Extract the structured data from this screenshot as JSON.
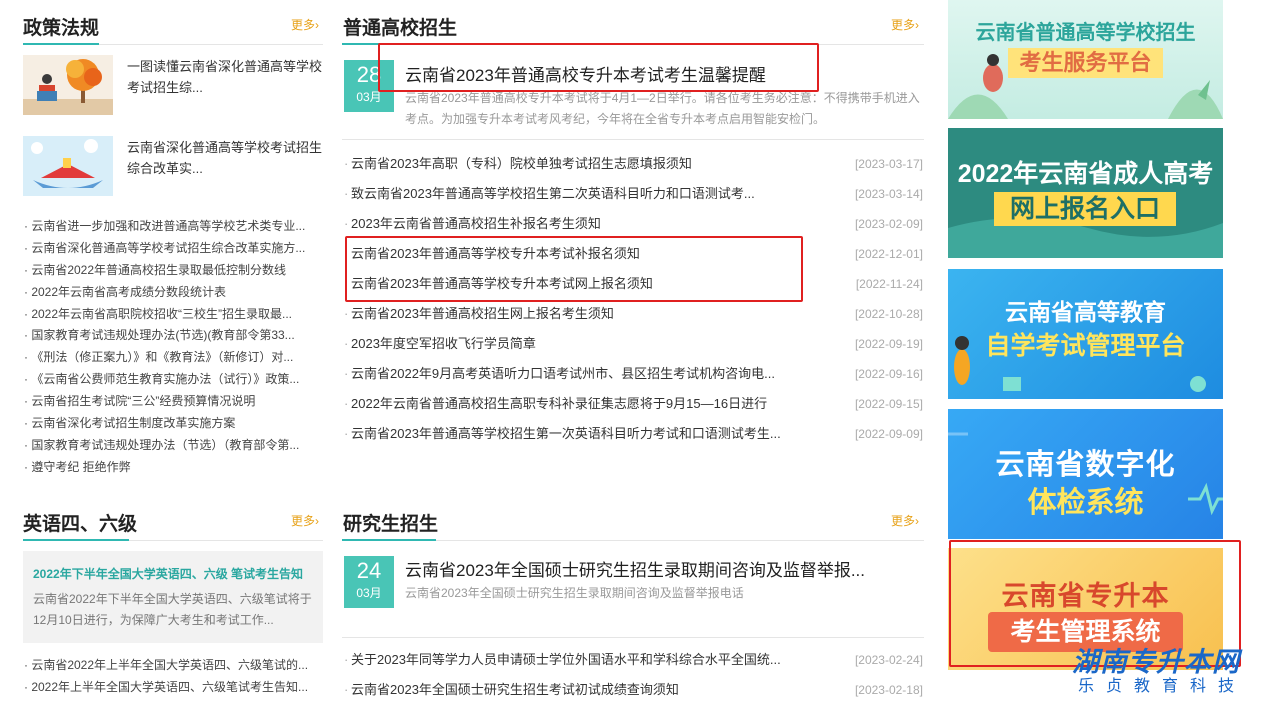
{
  "policy": {
    "title": "政策法规",
    "more": "更多›",
    "features": [
      {
        "text": "一图读懂云南省深化普通高等学校考试招生综..."
      },
      {
        "text": "云南省深化普通高等学校考试招生综合改革实..."
      }
    ],
    "items": [
      "· 云南省进一步加强和改进普通高等学校艺术类专业...",
      "· 云南省深化普通高等学校考试招生综合改革实施方...",
      "· 云南省2022年普通高校招生录取最低控制分数线",
      "· 2022年云南省高考成绩分数段统计表",
      "· 2022年云南省高职院校招收“三校生”招生录取最...",
      "· 国家教育考试违规处理办法(节选)(教育部令第33...",
      "· 《刑法（修正案九）》和《教育法》（新修订）对...",
      "· 《云南省公费师范生教育实施办法（试行）》政策...",
      "· 云南省招生考试院“三公”经费预算情况说明",
      "· 云南省深化考试招生制度改革实施方案",
      "· 国家教育考试违规处理办法（节选）（教育部令第...",
      "· 遵守考纪 拒绝作弊"
    ]
  },
  "admission": {
    "title": "普通高校招生",
    "more": "更多›",
    "top": {
      "day": "28",
      "month": "03月",
      "headline": "云南省2023年普通高校专升本考试考生温馨提醒",
      "summary": "云南省2023年普通高校专升本考试将于4月1—2日举行。请各位考生务必注意：不得携带手机进入考点。为加强专升本考试考风考纪，今年将在全省专升本考点启用智能安检门。"
    },
    "items": [
      {
        "title": "云南省2023年高职（专科）院校单独考试招生志愿填报须知",
        "date": "[2023-03-17]"
      },
      {
        "title": "致云南省2023年普通高等学校招生第二次英语科目听力和口语测试考...",
        "date": "[2023-03-14]"
      },
      {
        "title": "2023年云南省普通高校招生补报名考生须知",
        "date": "[2023-02-09]"
      },
      {
        "title": "云南省2023年普通高等学校专升本考试补报名须知",
        "date": "[2022-12-01]"
      },
      {
        "title": "云南省2023年普通高等学校专升本考试网上报名须知",
        "date": "[2022-11-24]"
      },
      {
        "title": "云南省2023年普通高校招生网上报名考生须知",
        "date": "[2022-10-28]"
      },
      {
        "title": "2023年度空军招收飞行学员简章",
        "date": "[2022-09-19]"
      },
      {
        "title": "云南省2022年9月高考英语听力口语考试州市、县区招生考试机构咨询电...",
        "date": "[2022-09-16]"
      },
      {
        "title": "2022年云南省普通高校招生高职专科补录征集志愿将于9月15—16日进行",
        "date": "[2022-09-15]"
      },
      {
        "title": "云南省2023年普通高等学校招生第一次英语科目听力考试和口语测试考生...",
        "date": "[2022-09-09]"
      }
    ]
  },
  "english": {
    "title": "英语四、六级",
    "more": "更多›",
    "card_title": "2022年下半年全国大学英语四、六级 笔试考生告知",
    "card_summary": "云南省2022年下半年全国大学英语四、六级笔试将于12月10日进行，为保障广大考生和考试工作...",
    "items": [
      "· 云南省2022年上半年全国大学英语四、六级笔试的...",
      "· 2022年上半年全国大学英语四、六级笔试考生告知..."
    ]
  },
  "graduate": {
    "title": "研究生招生",
    "more": "更多›",
    "top": {
      "day": "24",
      "month": "03月",
      "headline": "云南省2023年全国硕士研究生招生录取期间咨询及监督举报...",
      "summary": "云南省2023年全国硕士研究生招生录取期间咨询及监督举报电话"
    },
    "items": [
      {
        "title": "关于2023年同等学力人员申请硕士学位外国语水平和学科综合水平全国统...",
        "date": "[2023-02-24]"
      },
      {
        "title": "云南省2023年全国硕士研究生招生考试初试成绩查询须知",
        "date": "[2023-02-18]"
      }
    ]
  },
  "banners": [
    {
      "line1": "云南省普通高等学校招生",
      "line2": "考生服务平台"
    },
    {
      "line1": "2022年云南省成人高考",
      "line2": "网上报名入口"
    },
    {
      "line1": "云南省高等教育",
      "line2": "自学考试管理平台"
    },
    {
      "line1": "云南省数字化",
      "line2": "体检系统"
    },
    {
      "line1": "云南省专升本",
      "line2": "考生管理系统"
    }
  ],
  "watermark": {
    "line1": "湖南专升本网",
    "line2": "乐贞教育科技"
  },
  "colors": {
    "accent": "#49c5b6",
    "more": "#e7a21a",
    "highlight": "#e02020"
  }
}
